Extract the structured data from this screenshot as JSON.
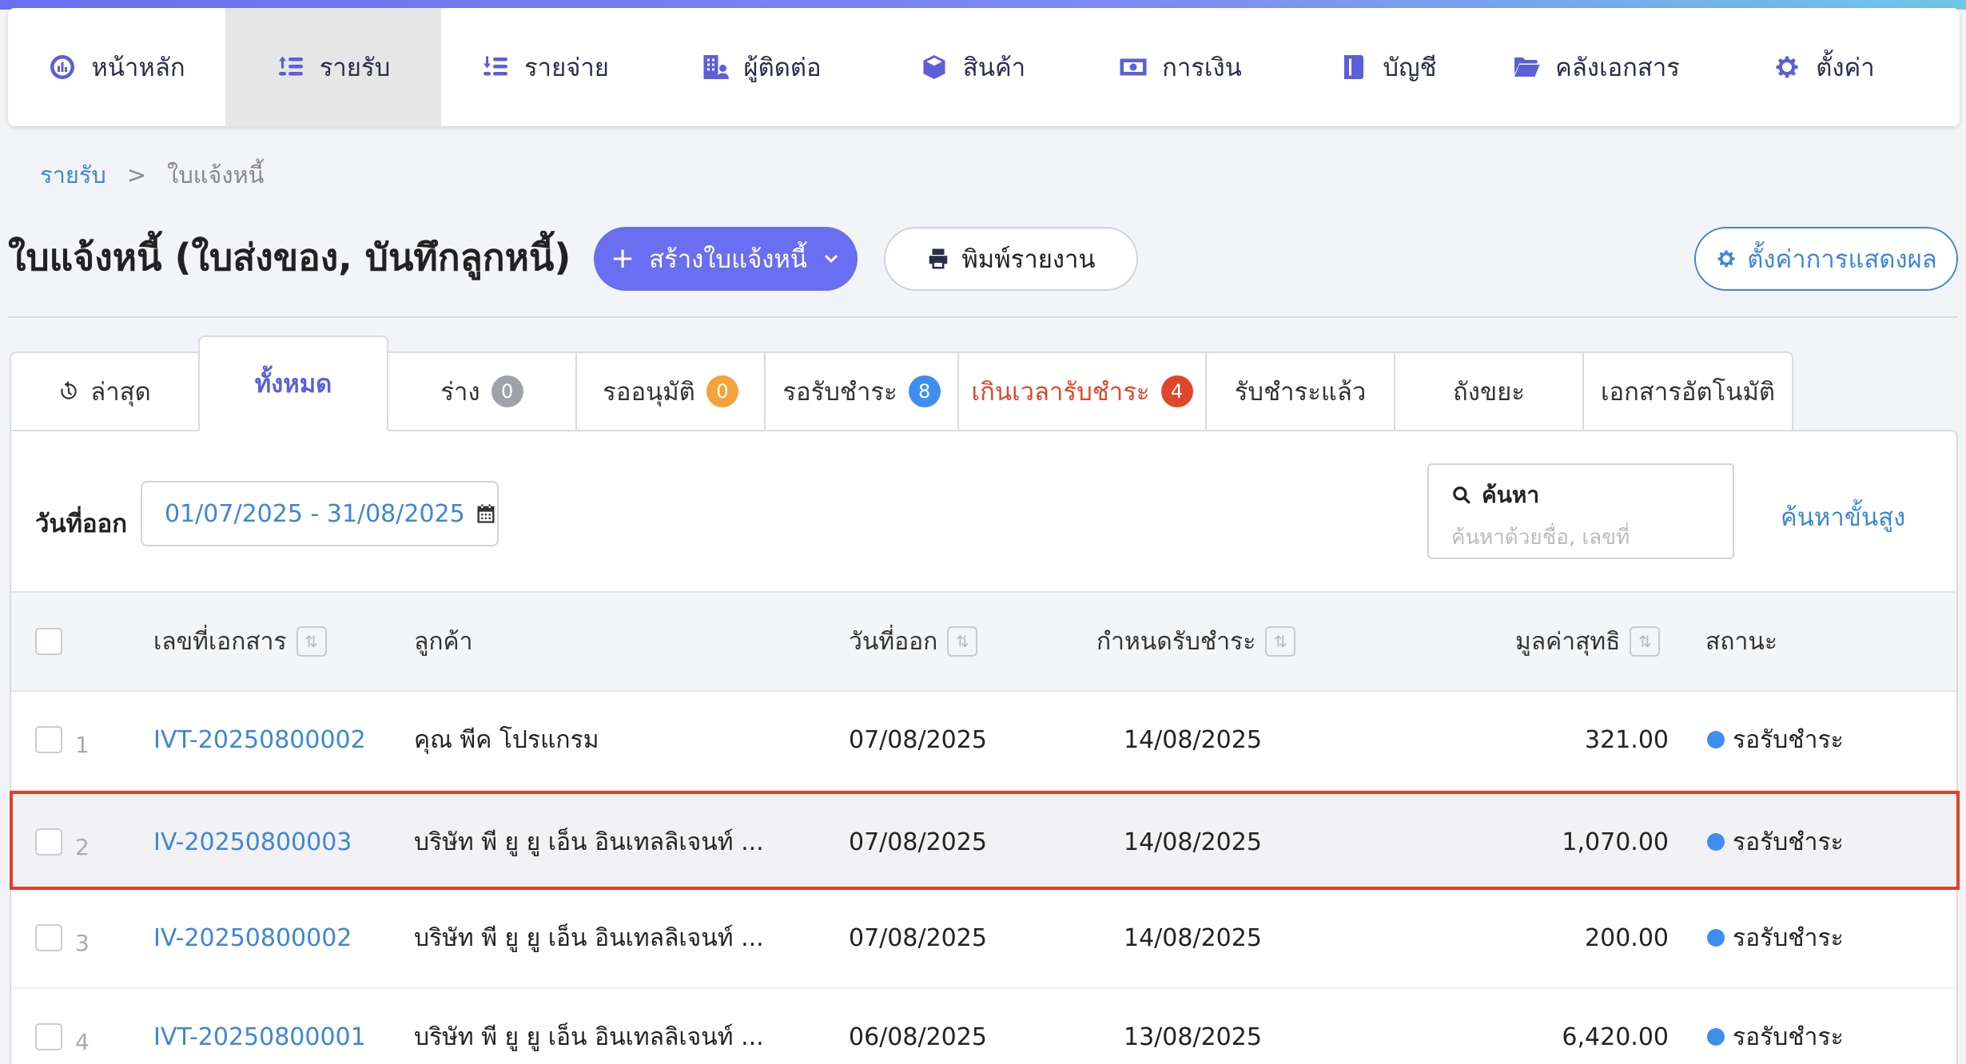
{
  "nav": {
    "items": [
      {
        "label": "หน้าหลัก",
        "icon": "dashboard-icon",
        "active": false
      },
      {
        "label": "รายรับ",
        "icon": "income-coins-icon",
        "active": true
      },
      {
        "label": "รายจ่าย",
        "icon": "expense-coins-icon",
        "active": false
      },
      {
        "label": "ผู้ติดต่อ",
        "icon": "contacts-building-icon",
        "active": false
      },
      {
        "label": "สินค้า",
        "icon": "box-icon",
        "active": false
      },
      {
        "label": "การเงิน",
        "icon": "money-icon",
        "active": false
      },
      {
        "label": "บัญชี",
        "icon": "ledger-icon",
        "active": false
      },
      {
        "label": "คลังเอกสาร",
        "icon": "folder-icon",
        "active": false
      },
      {
        "label": "ตั้งค่า",
        "icon": "gear-icon",
        "active": false
      }
    ]
  },
  "breadcrumb": {
    "parent": "รายรับ",
    "separator": ">",
    "current": "ใบแจ้งหนี้"
  },
  "header": {
    "title": "ใบแจ้งหนี้ (ใบส่งของ, บันทึกลูกหนี้)",
    "create_label": "สร้างใบแจ้งหนี้",
    "print_label": "พิมพ์รายงาน",
    "display_settings_label": "ตั้งค่าการแสดงผล"
  },
  "tabs": [
    {
      "label": "ล่าสุด",
      "badge": null
    },
    {
      "label": "ทั้งหมด",
      "badge": null
    },
    {
      "label": "ร่าง",
      "badge": "0"
    },
    {
      "label": "รออนุมัติ",
      "badge": "0"
    },
    {
      "label": "รอรับชำระ",
      "badge": "8"
    },
    {
      "label": "เกินเวลารับชำระ",
      "badge": "4"
    },
    {
      "label": "รับชำระแล้ว",
      "badge": null
    },
    {
      "label": "ถังขยะ",
      "badge": null
    },
    {
      "label": "เอกสารอัตโนมัติ",
      "badge": null
    }
  ],
  "filter": {
    "date_label": "วันที่ออก",
    "date_range": "01/07/2025 - 31/08/2025",
    "search_title": "ค้นหา",
    "search_placeholder": "ค้นหาด้วยชื่อ, เลขที่",
    "advanced_search": "ค้นหาขั้นสูง"
  },
  "table": {
    "columns": {
      "doc_no": "เลขที่เอกสาร",
      "customer": "ลูกค้า",
      "issue_date": "วันที่ออก",
      "due_date": "กำหนดรับชำระ",
      "net_value": "มูลค่าสุทธิ",
      "status": "สถานะ"
    },
    "rows": [
      {
        "num": "1",
        "doc_no": "IVT-20250800002",
        "customer": "คุณ พีค โปรแกรม",
        "issue_date": "07/08/2025",
        "due_date": "14/08/2025",
        "net_value": "321.00",
        "status": "รอรับชำระ"
      },
      {
        "num": "2",
        "doc_no": "IV-20250800003",
        "customer": "บริษัท พี ยู ยู เอ็น อินเทลลิเจนท์ ...",
        "issue_date": "07/08/2025",
        "due_date": "14/08/2025",
        "net_value": "1,070.00",
        "status": "รอรับชำระ"
      },
      {
        "num": "3",
        "doc_no": "IV-20250800002",
        "customer": "บริษัท พี ยู ยู เอ็น อินเทลลิเจนท์ ...",
        "issue_date": "07/08/2025",
        "due_date": "14/08/2025",
        "net_value": "200.00",
        "status": "รอรับชำระ"
      },
      {
        "num": "4",
        "doc_no": "IVT-20250800001",
        "customer": "บริษัท พี ยู ยู เอ็น อินเทลลิเจนท์ ...",
        "issue_date": "06/08/2025",
        "due_date": "13/08/2025",
        "net_value": "6,420.00",
        "status": "รอรับชำระ"
      }
    ]
  },
  "colors": {
    "accent": "#6a6ef0",
    "link": "#3f86d6",
    "danger": "#e0462b",
    "highlight_border": "#e0402a"
  }
}
